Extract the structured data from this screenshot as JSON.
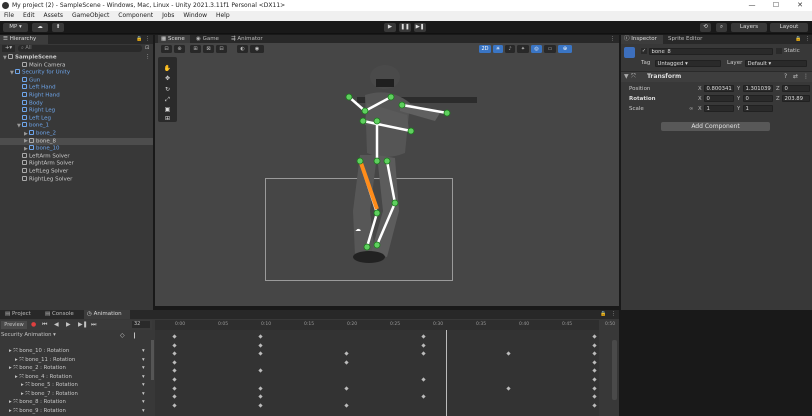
{
  "window": {
    "title": "My project (2) - SampleScene - Windows, Mac, Linux - Unity 2021.3.11f1 Personal <DX11>",
    "min": "—",
    "max": "☐",
    "close": "✕"
  },
  "menu": [
    "File",
    "Edit",
    "Assets",
    "GameObject",
    "Component",
    "Jobs",
    "Window",
    "Help"
  ],
  "toolbar": {
    "account": "MP ▾",
    "layers": "Layers",
    "layout": "Layout"
  },
  "hierarchy": {
    "tab": "Hierarchy",
    "search_placeholder": "All",
    "rows": [
      {
        "label": "SampleScene",
        "indent": 0,
        "arrow": "▼",
        "type": "scene",
        "selected": false,
        "blue": false
      },
      {
        "label": "Main Camera",
        "indent": 2,
        "arrow": "",
        "type": "go",
        "selected": false,
        "blue": false
      },
      {
        "label": "Security for Unity",
        "indent": 1,
        "arrow": "▼",
        "type": "prefab",
        "selected": false,
        "blue": true
      },
      {
        "label": "Gun",
        "indent": 2,
        "arrow": "",
        "type": "go",
        "selected": false,
        "blue": true
      },
      {
        "label": "Left Hand",
        "indent": 2,
        "arrow": "",
        "type": "go",
        "selected": false,
        "blue": true
      },
      {
        "label": "Right Hand",
        "indent": 2,
        "arrow": "",
        "type": "go",
        "selected": false,
        "blue": true
      },
      {
        "label": "Body",
        "indent": 2,
        "arrow": "",
        "type": "go",
        "selected": false,
        "blue": true
      },
      {
        "label": "Right Leg",
        "indent": 2,
        "arrow": "",
        "type": "go",
        "selected": false,
        "blue": true
      },
      {
        "label": "Left Leg",
        "indent": 2,
        "arrow": "",
        "type": "go",
        "selected": false,
        "blue": true
      },
      {
        "label": "bone_1",
        "indent": 2,
        "arrow": "▼",
        "type": "go",
        "selected": false,
        "blue": true
      },
      {
        "label": "bone_2",
        "indent": 3,
        "arrow": "▶",
        "type": "go",
        "selected": false,
        "blue": true
      },
      {
        "label": "bone_8",
        "indent": 3,
        "arrow": "▶",
        "type": "go",
        "selected": true,
        "blue": false
      },
      {
        "label": "bone_10",
        "indent": 3,
        "arrow": "▶",
        "type": "go",
        "selected": false,
        "blue": true
      },
      {
        "label": "LeftArm Solver",
        "indent": 2,
        "arrow": "",
        "type": "go",
        "selected": false,
        "blue": false
      },
      {
        "label": "RightArm Solver",
        "indent": 2,
        "arrow": "",
        "type": "go",
        "selected": false,
        "blue": false
      },
      {
        "label": "LeftLeg Solver",
        "indent": 2,
        "arrow": "",
        "type": "go",
        "selected": false,
        "blue": false
      },
      {
        "label": "RightLeg Solver",
        "indent": 2,
        "arrow": "",
        "type": "go",
        "selected": false,
        "blue": false
      }
    ]
  },
  "scene_tabs": {
    "scene": "Scene",
    "game": "Game",
    "animator": "Animator"
  },
  "scene_toolbar": {
    "mode_2d": "2D"
  },
  "inspector": {
    "tab": "Inspector",
    "tab2": "Sprite Editor",
    "object_name": "bone_8",
    "static_label": "Static",
    "tag_label": "Tag",
    "tag_value": "Untagged",
    "layer_label": "Layer",
    "layer_value": "Default",
    "component": "Transform",
    "position_label": "Position",
    "rotation_label": "Rotation",
    "scale_label": "Scale",
    "position": {
      "x": "0.800341",
      "y": "1.301039",
      "z": "0"
    },
    "rotation": {
      "x": "0",
      "y": "0",
      "z": "203.89"
    },
    "scale": {
      "x": "1",
      "y": "1"
    },
    "add_component": "Add Component"
  },
  "bottom_tabs": {
    "project": "Project",
    "console": "Console",
    "animation": "Animation"
  },
  "animation": {
    "preview": "Preview",
    "frame": "32",
    "clip": "Security Animation",
    "ticks": [
      "0:00",
      "0:05",
      "0:10",
      "0:15",
      "0:20",
      "0:25",
      "0:30",
      "0:35",
      "0:40",
      "0:45",
      "0:50"
    ],
    "rows": [
      "bone_10 : Rotation",
      "bone_11 : Rotation",
      "bone_2 : Rotation",
      "bone_4 : Rotation",
      "bone_5 : Rotation",
      "bone_7 : Rotation",
      "bone_8 : Rotation",
      "bone_9 : Rotation"
    ]
  }
}
